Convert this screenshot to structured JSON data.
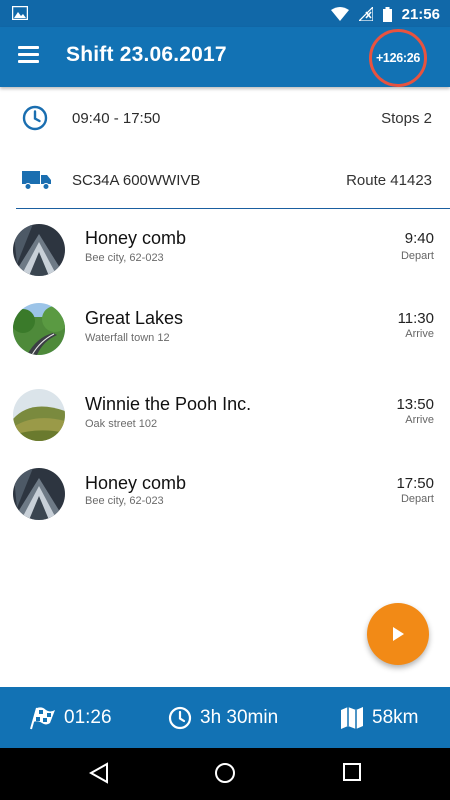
{
  "status_bar": {
    "time": "21:56",
    "icons": [
      "image-icon",
      "wifi-icon",
      "no-signal-icon",
      "battery-icon"
    ]
  },
  "header": {
    "title": "Shift 23.06.2017",
    "overtime": "+126:26",
    "accent_color": "#1272b4",
    "badge_ring_color": "#e8533f"
  },
  "shift_info": {
    "time_range": "09:40 - 17:50",
    "stops": "Stops 2",
    "vehicle": "SC34A 600WWIVB",
    "route": "Route 41423"
  },
  "stops": [
    {
      "name": "Honey comb",
      "address": "Bee city, 62-023",
      "time": "9:40",
      "type": "Depart",
      "image": "building-facade"
    },
    {
      "name": "Great Lakes",
      "address": "Waterfall town 12",
      "time": "11:30",
      "type": "Arrive",
      "image": "forest-road"
    },
    {
      "name": "Winnie the Pooh Inc.",
      "address": "Oak street 102",
      "time": "13:50",
      "type": "Arrive",
      "image": "grassy-hill"
    },
    {
      "name": "Honey comb",
      "address": "Bee city, 62-023",
      "time": "17:50",
      "type": "Depart",
      "image": "building-facade"
    }
  ],
  "fab": {
    "icon": "play-icon",
    "color": "#f28a16"
  },
  "summary": {
    "elapsed": "01:26",
    "duration": "3h 30min",
    "distance": "58km"
  }
}
